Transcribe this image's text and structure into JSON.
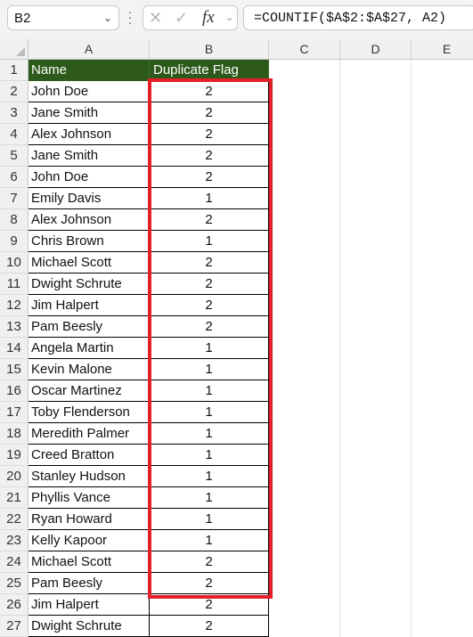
{
  "toolbar": {
    "name_box": "B2",
    "cancel_icon": "✕",
    "enter_icon": "✓",
    "fx_label": "fx",
    "formula": "=COUNTIF($A$2:$A$27, A2)"
  },
  "columns": [
    "A",
    "B",
    "C",
    "D",
    "E"
  ],
  "header": {
    "name": "Name",
    "flag": "Duplicate Flag"
  },
  "rows": [
    {
      "n": "2",
      "name": "John Doe",
      "flag": "2"
    },
    {
      "n": "3",
      "name": "Jane Smith",
      "flag": "2"
    },
    {
      "n": "4",
      "name": "Alex Johnson",
      "flag": "2"
    },
    {
      "n": "5",
      "name": "Jane Smith",
      "flag": "2"
    },
    {
      "n": "6",
      "name": "John Doe",
      "flag": "2"
    },
    {
      "n": "7",
      "name": "Emily Davis",
      "flag": "1"
    },
    {
      "n": "8",
      "name": "Alex Johnson",
      "flag": "2"
    },
    {
      "n": "9",
      "name": "Chris Brown",
      "flag": "1"
    },
    {
      "n": "10",
      "name": "Michael Scott",
      "flag": "2"
    },
    {
      "n": "11",
      "name": "Dwight Schrute",
      "flag": "2"
    },
    {
      "n": "12",
      "name": "Jim Halpert",
      "flag": "2"
    },
    {
      "n": "13",
      "name": "Pam Beesly",
      "flag": "2"
    },
    {
      "n": "14",
      "name": "Angela Martin",
      "flag": "1"
    },
    {
      "n": "15",
      "name": "Kevin Malone",
      "flag": "1"
    },
    {
      "n": "16",
      "name": "Oscar Martinez",
      "flag": "1"
    },
    {
      "n": "17",
      "name": "Toby Flenderson",
      "flag": "1"
    },
    {
      "n": "18",
      "name": "Meredith Palmer",
      "flag": "1"
    },
    {
      "n": "19",
      "name": "Creed Bratton",
      "flag": "1"
    },
    {
      "n": "20",
      "name": "Stanley Hudson",
      "flag": "1"
    },
    {
      "n": "21",
      "name": "Phyllis Vance",
      "flag": "1"
    },
    {
      "n": "22",
      "name": "Ryan Howard",
      "flag": "1"
    },
    {
      "n": "23",
      "name": "Kelly Kapoor",
      "flag": "1"
    },
    {
      "n": "24",
      "name": "Michael Scott",
      "flag": "2"
    },
    {
      "n": "25",
      "name": "Pam Beesly",
      "flag": "2"
    },
    {
      "n": "26",
      "name": "Jim Halpert",
      "flag": "2"
    },
    {
      "n": "27",
      "name": "Dwight Schrute",
      "flag": "2"
    }
  ],
  "colors": {
    "header_fill": "#2d5a1b",
    "highlight": "#e3202a"
  }
}
